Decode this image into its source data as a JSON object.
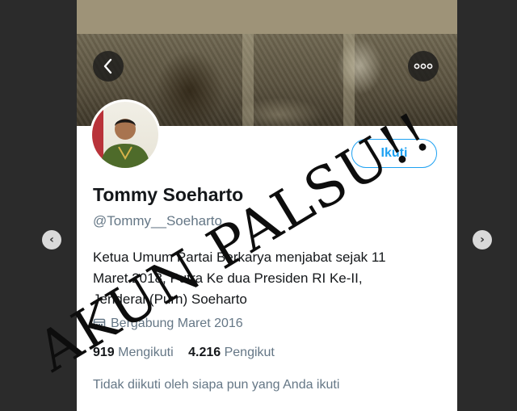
{
  "gallery": {
    "prev_glyph": "‹",
    "next_glyph": "›"
  },
  "header": {
    "back_icon": "chevron-left-icon",
    "more_icon": "ellipsis-icon"
  },
  "profile": {
    "display_name": "Tommy Soeharto",
    "handle": "@Tommy__Soeharto",
    "follow_label": "Ikuti",
    "bio_lines": [
      "Ketua Umum Partai Berkarya menjabat sejak 11",
      "Maret 2018, Putra Ke dua Presiden RI Ke-II,",
      "Jenderal (Purn) Soeharto"
    ],
    "joined": "Bergabung Maret 2016",
    "following_count": "919",
    "following_label": "Mengikuti",
    "followers_count": "4.216",
    "followers_label": "Pengikut",
    "followed_by_note": "Tidak diikuti oleh siapa pun yang Anda ikuti"
  },
  "overlay": {
    "stamp_text": "AKUN PALSU!!"
  },
  "colors": {
    "accent": "#1da1f2",
    "text_primary": "#14171a",
    "text_secondary": "#657786"
  }
}
